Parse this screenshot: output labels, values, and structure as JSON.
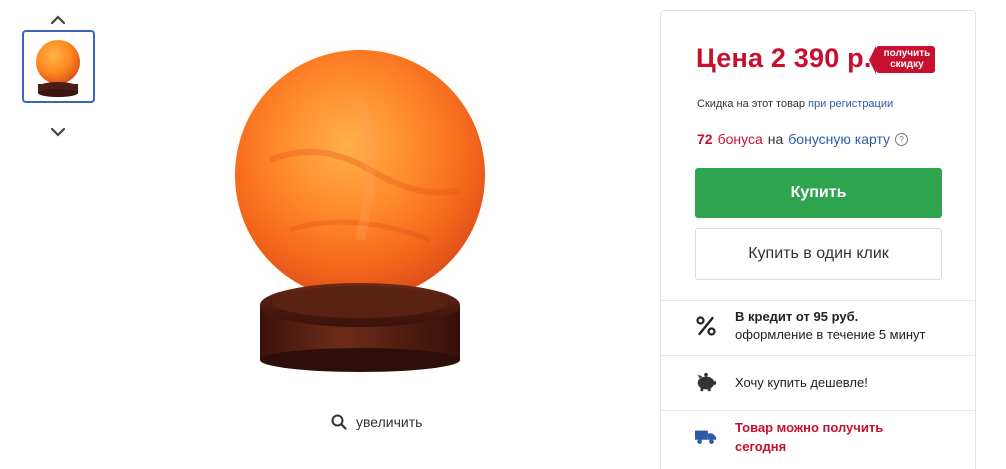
{
  "gallery": {
    "thumbnail_icon": "salt-lamp-thumbnail",
    "arrow_up_icon": "chevron-up-icon",
    "arrow_down_icon": "chevron-down-icon",
    "zoom_label": "увеличить",
    "zoom_icon": "search-icon"
  },
  "product": {
    "image_icon": "salt-lamp-sphere-image"
  },
  "pricing": {
    "price": "Цена 2 390 р.",
    "discount_tag": [
      "получить",
      "скидку"
    ],
    "discount_note_prefix": "Скидка на этот товар",
    "discount_note_link": "при регистрации",
    "bonus_count": "72",
    "bonus_word": "бонуса",
    "bonus_on": "на",
    "bonus_link": "бонусную карту",
    "info_icon": "?"
  },
  "actions": {
    "buy_label": "Купить",
    "one_click_label": "Купить в один клик"
  },
  "features": {
    "credit_title": "В кредит от 95 руб.",
    "credit_sub": "оформление в течение 5 минут",
    "credit_icon": "percent-icon",
    "cheaper_label": "Хочу купить дешевле!",
    "cheaper_icon": "piggy-bank-icon",
    "delivery_text": "Товар можно получить сегодня",
    "delivery_icon": "truck-icon"
  },
  "colors": {
    "price_red": "#c8102e",
    "buy_green": "#2ea44f",
    "link_blue": "#2d5aa8",
    "thumb_border": "#3b66b8"
  }
}
